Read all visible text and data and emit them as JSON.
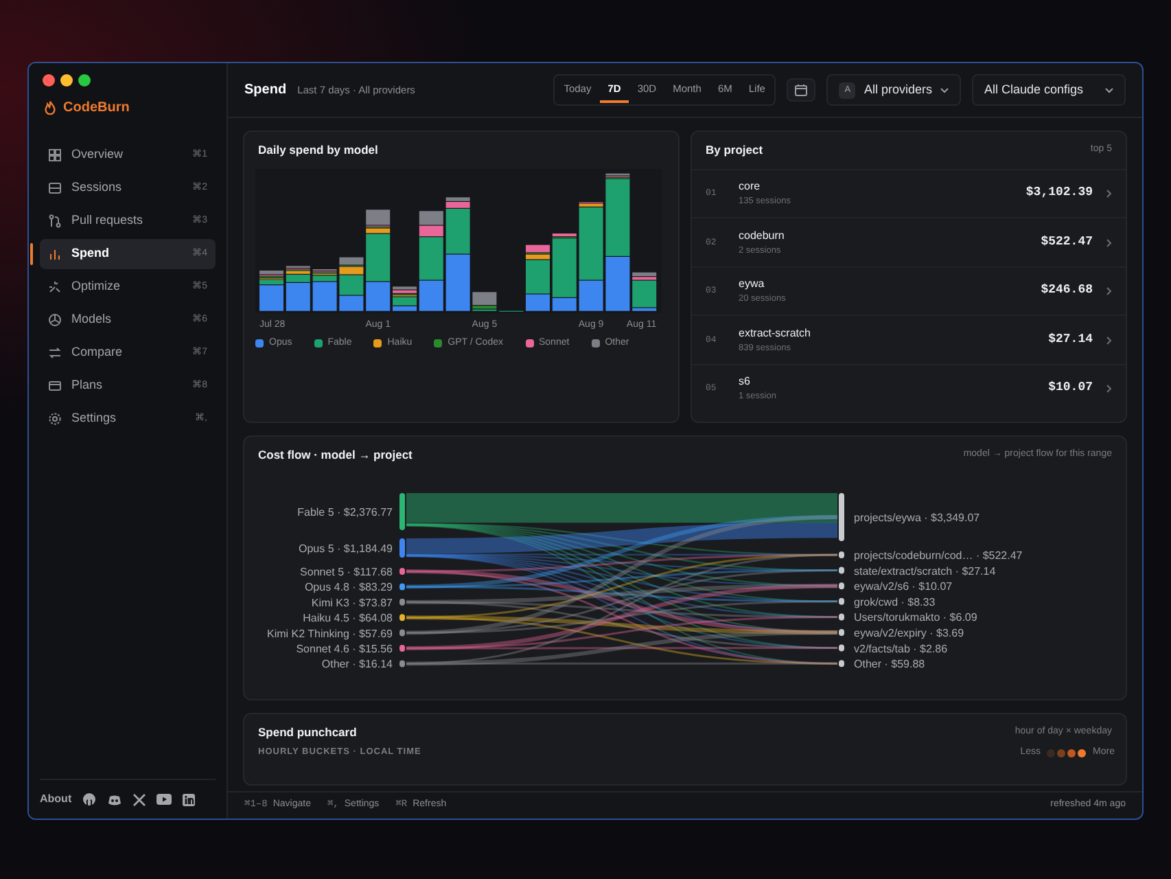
{
  "app": {
    "name": "CodeBurn"
  },
  "sidebar": {
    "items": [
      {
        "label": "Overview",
        "shortcut": "⌘1",
        "selected": false
      },
      {
        "label": "Sessions",
        "shortcut": "⌘2",
        "selected": false
      },
      {
        "label": "Pull requests",
        "shortcut": "⌘3",
        "selected": false
      },
      {
        "label": "Spend",
        "shortcut": "⌘4",
        "selected": true
      },
      {
        "label": "Optimize",
        "shortcut": "⌘5",
        "selected": false
      },
      {
        "label": "Models",
        "shortcut": "⌘6",
        "selected": false
      },
      {
        "label": "Compare",
        "shortcut": "⌘7",
        "selected": false
      },
      {
        "label": "Plans",
        "shortcut": "⌘8",
        "selected": false
      },
      {
        "label": "Settings",
        "shortcut": "⌘,",
        "selected": false
      }
    ],
    "about": "About"
  },
  "header": {
    "title": "Spend",
    "subtitle": "Last 7 days · All providers",
    "ranges": [
      {
        "label": "Today",
        "selected": false
      },
      {
        "label": "7D",
        "selected": true
      },
      {
        "label": "30D",
        "selected": false
      },
      {
        "label": "Month",
        "selected": false
      },
      {
        "label": "6M",
        "selected": false
      },
      {
        "label": "Life",
        "selected": false
      }
    ],
    "provider": {
      "badge": "A",
      "label": "All providers"
    },
    "config": {
      "label": "All Claude configs"
    }
  },
  "daily_chart": {
    "title": "Daily spend by model",
    "x_labels": [
      "Jul 28",
      "Aug 1",
      "Aug 5",
      "Aug 9",
      "Aug 11"
    ],
    "legend": [
      {
        "label": "Opus",
        "color": "#3d86f0"
      },
      {
        "label": "Fable",
        "color": "#1fa06f"
      },
      {
        "label": "Haiku",
        "color": "#e79b1c"
      },
      {
        "label": "GPT / Codex",
        "color": "#2a8a2e"
      },
      {
        "label": "Sonnet",
        "color": "#e9669a"
      },
      {
        "label": "Other",
        "color": "#7d7f86"
      }
    ]
  },
  "projects": {
    "title": "By project",
    "note": "top 5",
    "rows": [
      {
        "rank": "01",
        "name": "core",
        "sessions": "135 sessions",
        "cost": "$3,102.39"
      },
      {
        "rank": "02",
        "name": "codeburn",
        "sessions": "2 sessions",
        "cost": "$522.47"
      },
      {
        "rank": "03",
        "name": "eywa",
        "sessions": "20 sessions",
        "cost": "$246.68"
      },
      {
        "rank": "04",
        "name": "extract-scratch",
        "sessions": "839 sessions",
        "cost": "$27.14"
      },
      {
        "rank": "05",
        "name": "s6",
        "sessions": "1 session",
        "cost": "$10.07"
      }
    ]
  },
  "cost_flow": {
    "title": "Cost flow · model → project",
    "note": "model → project flow for this range",
    "models": [
      {
        "label": "Fable 5 · $2,376.77",
        "color": "#2bb673"
      },
      {
        "label": "Opus 5 · $1,184.49",
        "color": "#3d86f0"
      },
      {
        "label": "Sonnet 5 · $117.68",
        "color": "#e9669a"
      },
      {
        "label": "Opus 4.8 · $83.29",
        "color": "#3d9df6"
      },
      {
        "label": "Kimi K3 · $73.87",
        "color": "#8a8c92"
      },
      {
        "label": "Haiku 4.5 · $64.08",
        "color": "#e5b323"
      },
      {
        "label": "Kimi K2 Thinking · $57.69",
        "color": "#8a8c92"
      },
      {
        "label": "Sonnet 4.6 · $15.56",
        "color": "#e9669a"
      },
      {
        "label": "Other · $16.14",
        "color": "#8a8c92"
      }
    ],
    "projects": [
      {
        "label": "projects/eywa · $3,349.07"
      },
      {
        "label": "projects/codeburn/cod… · $522.47"
      },
      {
        "label": "state/extract/scratch · $27.14"
      },
      {
        "label": "eywa/v2/s6 · $10.07"
      },
      {
        "label": "grok/cwd · $8.33"
      },
      {
        "label": "Users/torukmakto · $6.09"
      },
      {
        "label": "eywa/v2/expiry · $3.69"
      },
      {
        "label": "v2/facts/tab · $2.86"
      },
      {
        "label": "Other · $59.88"
      }
    ]
  },
  "punchcard": {
    "title": "Spend punchcard",
    "note": "hour of day × weekday",
    "caption": "HOURLY BUCKETS · LOCAL TIME",
    "legend_low": "Less",
    "legend_high": "More"
  },
  "footer": {
    "hints": [
      {
        "key": "⌘1–8",
        "label": "Navigate"
      },
      {
        "key": "⌘,",
        "label": "Settings"
      },
      {
        "key": "⌘R",
        "label": "Refresh"
      }
    ],
    "status": "refreshed 4m ago"
  }
}
